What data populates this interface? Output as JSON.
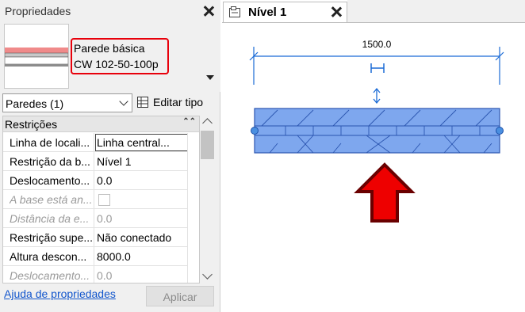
{
  "properties_panel": {
    "title": "Propriedades",
    "type_name_line1": "Parede básica",
    "type_name_line2": "CW 102-50-100p",
    "instance_selector": "Paredes (1)",
    "edit_type_label": "Editar tipo",
    "section_label": "Restrições",
    "rows": [
      {
        "name": "Linha de locali...",
        "value": "Linha central..."
      },
      {
        "name": "Restrição da b...",
        "value": "Nível 1"
      },
      {
        "name": "Deslocamento...",
        "value": "0.0"
      },
      {
        "name": "A base está an...",
        "value": ""
      },
      {
        "name": "Distância da e...",
        "value": "0.0"
      },
      {
        "name": "Restrição supe...",
        "value": "Não conectado"
      },
      {
        "name": "Altura descon...",
        "value": "8000.0"
      },
      {
        "name": "Deslocamento...",
        "value": "0.0"
      }
    ],
    "help_link": "Ajuda de propriedades",
    "apply_label": "Aplicar"
  },
  "view": {
    "tab_label": "Nível 1",
    "dimension_text": "1500.0"
  },
  "colors": {
    "wall_fill": "#7ea7ee",
    "wall_stroke": "#2b55b0",
    "arrow_fill": "#ee0000",
    "arrow_stroke": "#6a0000",
    "highlight_border": "#e8000b",
    "dimension_line": "#1b6bd6"
  },
  "icons": [
    "close-icon",
    "view-tab-icon",
    "edit-type-icon",
    "chevron-down-icon",
    "collapse-icon",
    "scroll-up-icon",
    "scroll-down-icon",
    "flip-arrows-icon"
  ]
}
